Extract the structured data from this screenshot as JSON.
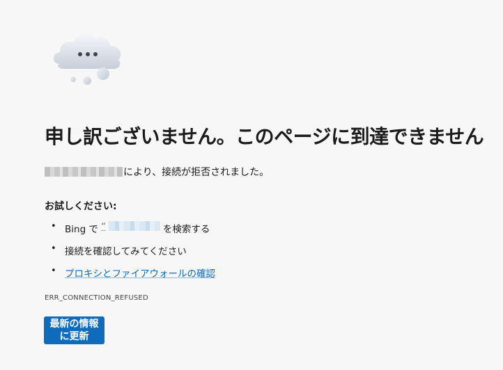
{
  "illustration": {
    "icon": "cloud-with-dots-icon",
    "colors": {
      "cloud_light": "#eef1f6",
      "cloud_shadow": "#c4cad5",
      "dots": "#3f4450",
      "bubbles": "#cfd6e2"
    }
  },
  "heading": "申し訳ございません。このページに到達できません",
  "refused": {
    "host_redacted": true,
    "message": "により、接続が拒否されました。"
  },
  "try_heading": "お試しください:",
  "suggestions": [
    {
      "bullet": "•",
      "prefix": "Bing で ",
      "quote_open": "“",
      "query_redacted": true,
      "suffix": "を検索する"
    },
    {
      "bullet": "•",
      "text": "接続を確認してみてください"
    },
    {
      "bullet": "•",
      "link_text": "プロキシとファイアウォールの確認"
    }
  ],
  "error_code": "ERR_CONNECTION_REFUSED",
  "refresh_button_label": "最新の情報に更新",
  "colors": {
    "accent": "#0f6cbd",
    "link": "#0b67b8",
    "background": "#f7f7f7",
    "text": "#1b1b1b"
  }
}
